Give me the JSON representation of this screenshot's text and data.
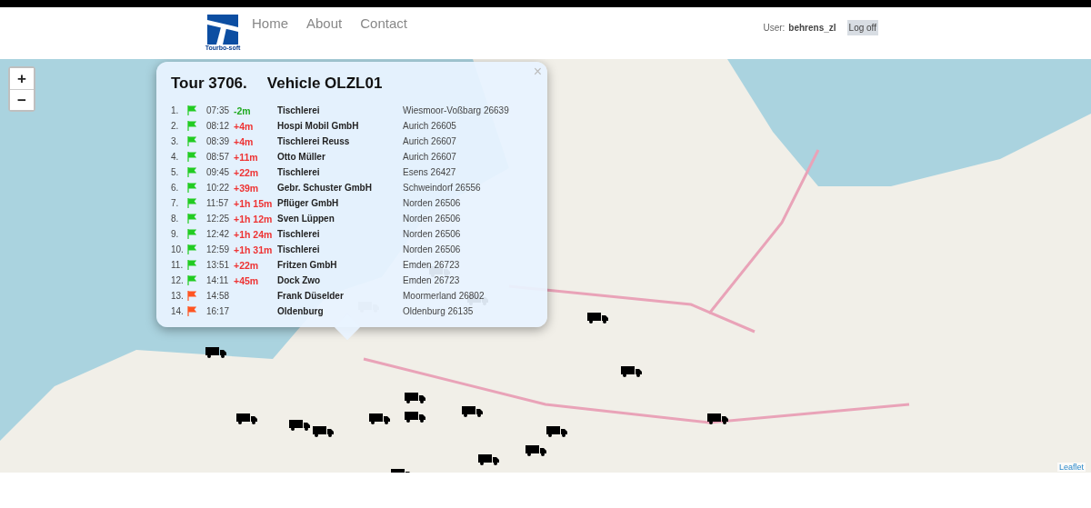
{
  "header": {
    "logo_text": "Tourbo-soft",
    "nav": [
      {
        "label": "Home"
      },
      {
        "label": "About"
      },
      {
        "label": "Contact"
      }
    ],
    "user_label": "User:",
    "username": "behrens_zl",
    "logoff": "Log off"
  },
  "map": {
    "zoom_in": "+",
    "zoom_out": "−",
    "attribution": "Leaflet",
    "popup": {
      "close": "×",
      "title": "Tour 3706.",
      "vehicle": "Vehicle OLZL01",
      "stops": [
        {
          "number": "1.",
          "color": "#22cc22",
          "time": "07:35",
          "delay": {
            "text": "-2m",
            "color": "#22aa22"
          },
          "name": "Tischlerei",
          "address": "Wiesmoor-Voßbarg 26639"
        },
        {
          "number": "2.",
          "color": "#22cc22",
          "time": "08:12",
          "delay": {
            "text": "+4m",
            "color": "#ee3333"
          },
          "name": "Hospi Mobil GmbH",
          "address": "Aurich 26605"
        },
        {
          "number": "3.",
          "color": "#22cc22",
          "time": "08:39",
          "delay": {
            "text": "+4m",
            "color": "#ee3333"
          },
          "name": "Tischlerei Reuss",
          "address": "Aurich 26607"
        },
        {
          "number": "4.",
          "color": "#22cc22",
          "time": "08:57",
          "delay": {
            "text": "+11m",
            "color": "#ee3333"
          },
          "name": "Otto Müller",
          "address": "Aurich 26607"
        },
        {
          "number": "5.",
          "color": "#22cc22",
          "time": "09:45",
          "delay": {
            "text": "+22m",
            "color": "#ee3333"
          },
          "name": "Tischlerei",
          "address": "Esens 26427"
        },
        {
          "number": "6.",
          "color": "#22cc22",
          "time": "10:22",
          "delay": {
            "text": "+39m",
            "color": "#ee3333"
          },
          "name": "Gebr. Schuster GmbH",
          "address": "Schweindorf 26556"
        },
        {
          "number": "7.",
          "color": "#22cc22",
          "time": "11:57",
          "delay": {
            "text": "+1h 15m",
            "color": "#ee3333"
          },
          "name": "Pflüger GmbH",
          "address": "Norden 26506"
        },
        {
          "number": "8.",
          "color": "#22cc22",
          "time": "12:25",
          "delay": {
            "text": "+1h 12m",
            "color": "#ee3333"
          },
          "name": "Sven Lüppen",
          "address": "Norden 26506"
        },
        {
          "number": "9.",
          "color": "#22cc22",
          "time": "12:42",
          "delay": {
            "text": "+1h 24m",
            "color": "#ee3333"
          },
          "name": "Tischlerei",
          "address": "Norden 26506"
        },
        {
          "number": "10.",
          "color": "#22cc22",
          "time": "12:59",
          "delay": {
            "text": "+1h 31m",
            "color": "#ee3333"
          },
          "name": "Tischlerei",
          "address": "Norden 26506"
        },
        {
          "number": "11.",
          "color": "#22cc22",
          "time": "13:51",
          "delay": {
            "text": "+22m",
            "color": "#ee3333"
          },
          "name": "Fritzen GmbH",
          "address": "Emden 26723"
        },
        {
          "number": "12.",
          "color": "#22cc22",
          "time": "14:11",
          "delay": {
            "text": "+45m",
            "color": "#ee3333"
          },
          "name": "Dock Zwo",
          "address": "Emden 26723"
        },
        {
          "number": "13.",
          "color": "#ff5522",
          "time": "14:58",
          "name": "Frank Düselder",
          "address": "Moormerland 26802"
        },
        {
          "number": "14.",
          "color": "#ff5522",
          "time": "16:17",
          "name": "Oldenburg",
          "address": "Oldenburg 26135"
        }
      ]
    }
  }
}
